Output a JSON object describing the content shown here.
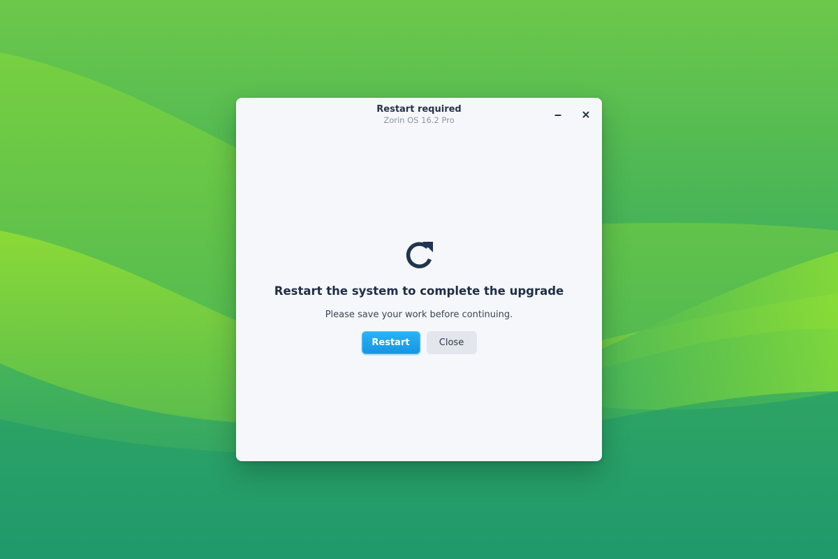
{
  "window": {
    "title": "Restart required",
    "subtitle": "Zorin OS 16.2 Pro"
  },
  "titlebar_controls": {
    "minimize_icon": "minimize-icon",
    "close_icon": "close-icon"
  },
  "dialog": {
    "icon": "restart-icon",
    "headline": "Restart the system to complete the upgrade",
    "message": "Please save your work before continuing.",
    "primary_button": "Restart",
    "secondary_button": "Close"
  },
  "colors": {
    "accent": "#1aa1ec",
    "icon": "#1f3550",
    "window_bg": "#f6f7fa"
  }
}
